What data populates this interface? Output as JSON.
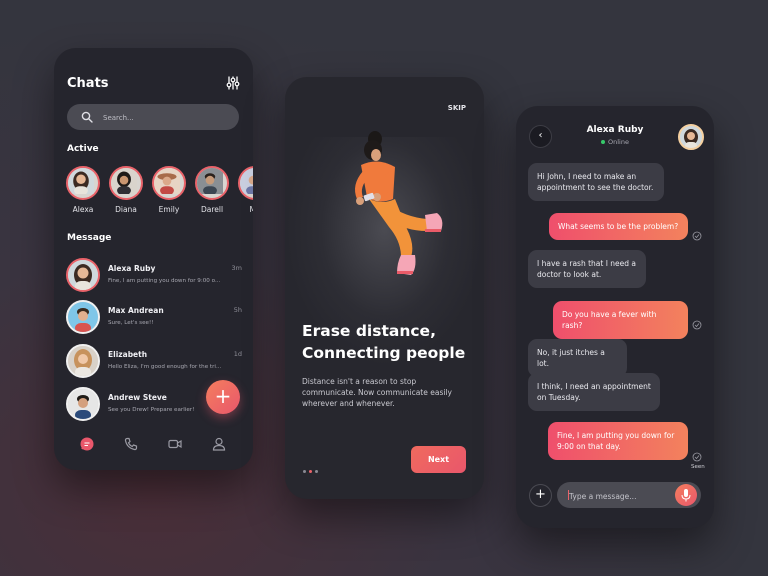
{
  "chats_screen": {
    "title": "Chats",
    "search_placeholder": "Search...",
    "active_heading": "Active",
    "active_users": [
      {
        "name": "Alexa"
      },
      {
        "name": "Diana"
      },
      {
        "name": "Emily"
      },
      {
        "name": "Darell"
      },
      {
        "name": "Me"
      }
    ],
    "message_heading": "Message",
    "messages": [
      {
        "name": "Alexa Ruby",
        "preview": "Fine, I am putting you down for 9:00 o...",
        "time": "3m"
      },
      {
        "name": "Max Andrean",
        "preview": "Sure, Let's see!!",
        "time": "5h"
      },
      {
        "name": "Elizabeth",
        "preview": "Hello Eliza, I'm good enough for the tri...",
        "time": "1d"
      },
      {
        "name": "Andrew Steve",
        "preview": "See you Drew! Prepare earlier!",
        "time": ""
      }
    ],
    "fab_label": "+",
    "icons": [
      "filter-icon",
      "search-icon",
      "chat-icon",
      "phone-icon",
      "video-icon",
      "profile-icon"
    ],
    "accent": "#e9636a"
  },
  "onboarding_screen": {
    "skip_label": "SKIP",
    "headline_line1": "Erase distance,",
    "headline_line2": "Connecting people",
    "subtitle": "Distance isn't a reason to stop communicate. Now communicate easily wherever and whenever.",
    "next_label": "Next",
    "pages_total": 3,
    "current_page": 2
  },
  "conversation_screen": {
    "back_label": "‹",
    "contact_name": "Alexa Ruby",
    "status": "Online",
    "messages": [
      {
        "direction": "in",
        "text": "Hi John, I need to make an appointment to see the doctor."
      },
      {
        "direction": "out",
        "text": "What seems to be the problem?"
      },
      {
        "direction": "in",
        "text": "I have a rash that I need a doctor to look at."
      },
      {
        "direction": "out",
        "text": "Do you have a fever with rash?"
      },
      {
        "direction": "in",
        "text": "No, it just itches a lot."
      },
      {
        "direction": "in",
        "text": "I think, I need an appointment on Tuesday."
      },
      {
        "direction": "out",
        "text": "Fine, I am putting you down for 9:00 on that day."
      }
    ],
    "seen_label": "Seen",
    "plus_label": "+",
    "input_placeholder": "Type a message...",
    "status_color": "#37c86a"
  }
}
